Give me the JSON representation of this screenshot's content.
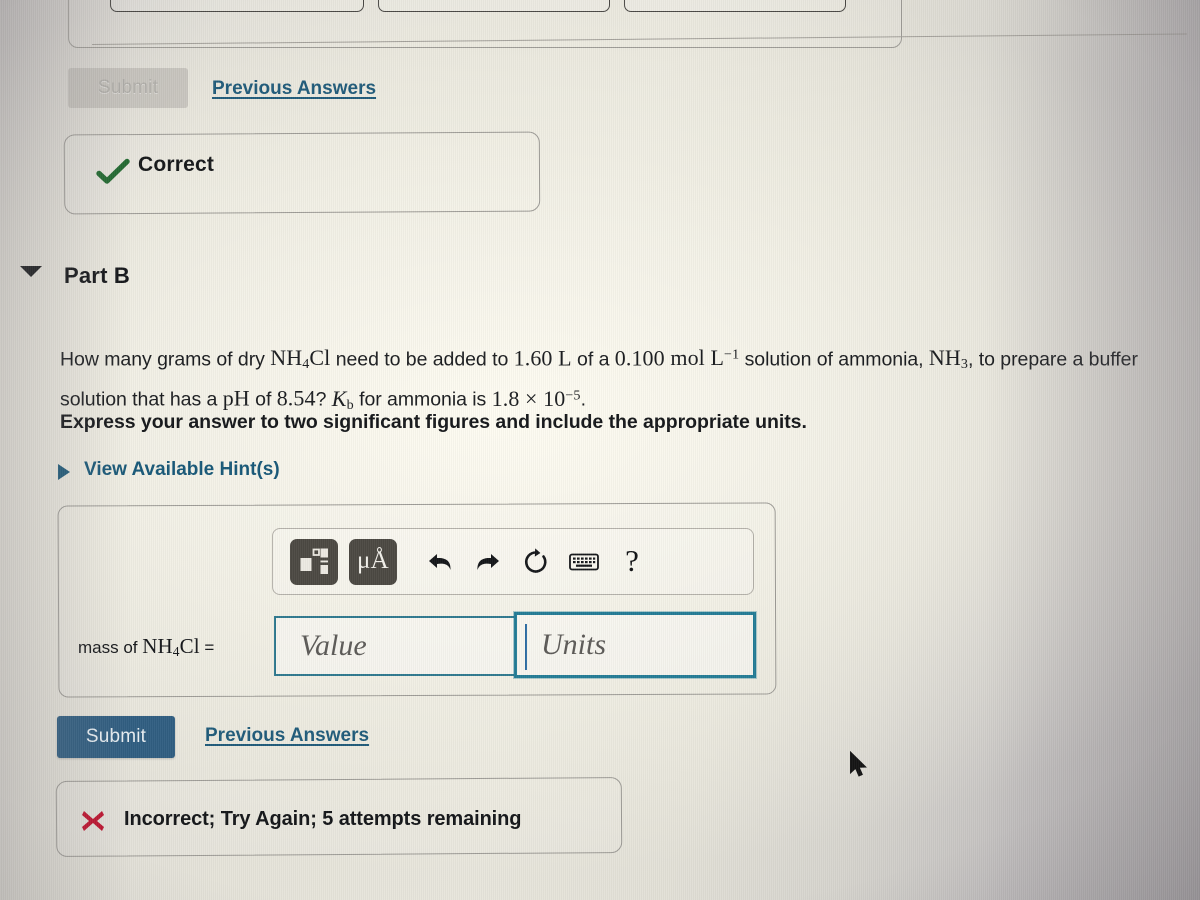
{
  "part_a": {
    "submit_label": "Submit",
    "submit_disabled": true,
    "previous_answers_label": "Previous Answers",
    "feedback": {
      "icon": "check-icon",
      "text": "Correct"
    }
  },
  "part_b": {
    "title": "Part B",
    "expanded": true,
    "toggle_icon": "triangle-down-icon",
    "question": {
      "line1_a": "How many grams of dry ",
      "nh4cl": "NH",
      "nh4cl_sub": "4",
      "nh4cl_tail": "Cl",
      "line1_b": " need to be added to ",
      "volume": "1.60",
      "volume_unit": "L",
      "line1_c": " of a ",
      "concentration": "0.100",
      "concentration_unit": "mol L",
      "concentration_exp": "−1",
      "line1_d": " solution of ammonia, ",
      "nh3": "NH",
      "nh3_sub": "3",
      "line1_e": ", to prepare a buffer solution that has a ",
      "ph": "pH",
      "line1_f": " of ",
      "ph_value": "8.54",
      "line1_g": "? ",
      "kb": "K",
      "kb_sub": "b",
      "line1_h": " for ammonia is ",
      "kb_mantissa": "1.8",
      "kb_times": "×",
      "kb_base": "10",
      "kb_exp": "−5",
      "line1_i": "."
    },
    "instruction": "Express your answer to two significant figures and include the appropriate units.",
    "hints": {
      "caret_icon": "triangle-right-icon",
      "label": "View Available Hint(s)"
    },
    "toolbar": [
      {
        "name": "math-template-icon",
        "type": "square",
        "label": ""
      },
      {
        "name": "units-icon",
        "type": "square",
        "label": "μÅ"
      },
      {
        "name": "undo-icon",
        "type": "plain",
        "label": ""
      },
      {
        "name": "redo-icon",
        "type": "plain",
        "label": ""
      },
      {
        "name": "reset-icon",
        "type": "plain",
        "label": ""
      },
      {
        "name": "keyboard-icon",
        "type": "plain",
        "label": ""
      },
      {
        "name": "help-icon",
        "type": "plain",
        "label": "?"
      }
    ],
    "answer": {
      "label_prefix": "mass of ",
      "label_formula": "NH",
      "label_formula_sub": "4",
      "label_formula_tail": "Cl",
      "label_equals": " =",
      "value_placeholder": "Value",
      "value_text": "",
      "units_placeholder": "Units",
      "units_text": "",
      "focused_field": "units"
    },
    "submit_label": "Submit",
    "previous_answers_label": "Previous Answers",
    "feedback": {
      "icon": "cross-icon",
      "text": "Incorrect; Try Again; 5 attempts remaining"
    }
  },
  "cursor": {
    "icon": "mouse-pointer-icon"
  },
  "colors": {
    "link": "#1c5c7d",
    "submit_button": "#2d5f84",
    "correct_green": "#1f6b2e",
    "incorrect_red": "#c8102e",
    "field_border_focus": "#1f7d99",
    "field_border": "#2a7a92",
    "toolbar_icon_bg": "#4c4943"
  }
}
